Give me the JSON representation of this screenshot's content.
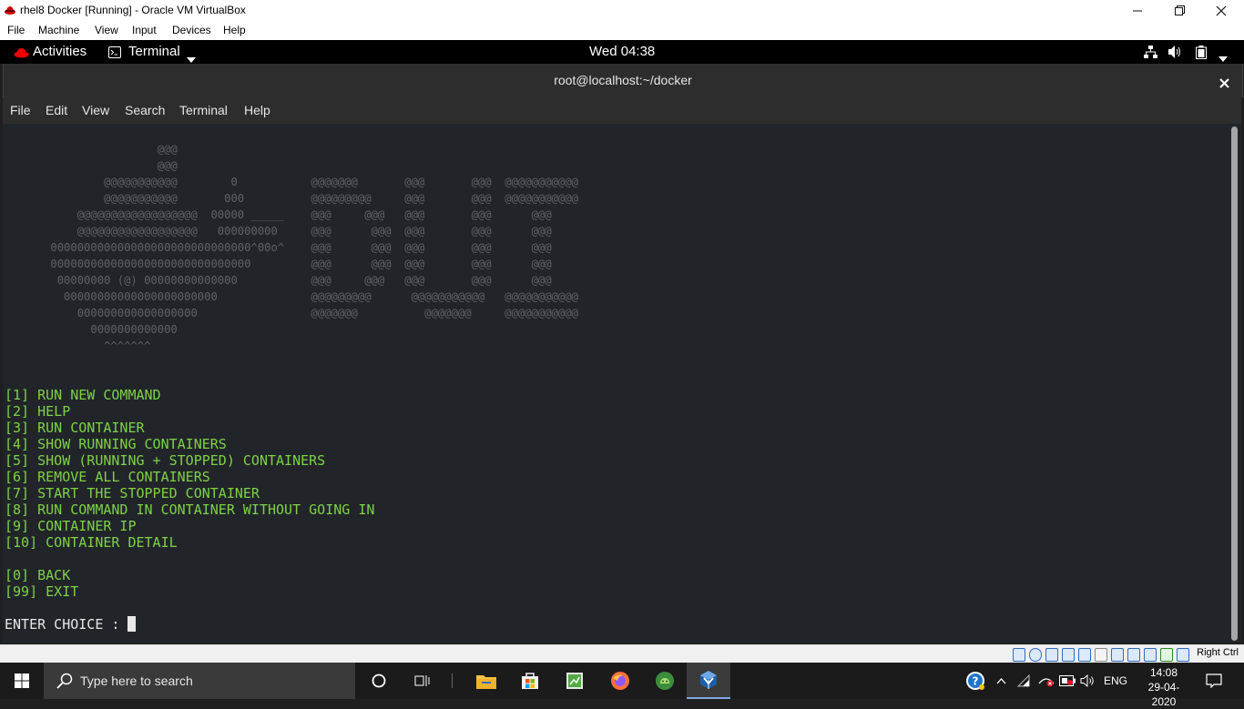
{
  "vbox": {
    "title": "rhel8 Docker [Running] - Oracle VM VirtualBox",
    "menu": [
      "File",
      "Machine",
      "View",
      "Input",
      "Devices",
      "Help"
    ],
    "host_key": "Right Ctrl"
  },
  "gnome": {
    "activities": "Activities",
    "app_menu": "Terminal",
    "clock": "Wed 04:38"
  },
  "terminal": {
    "title": "root@localhost:~/docker",
    "menu": [
      "File",
      "Edit",
      "View",
      "Search",
      "Terminal",
      "Help"
    ],
    "ascii_art": [
      "                       @@@",
      "                       @@@",
      "               @@@@@@@@@@@        0           @@@@@@@       @@@       @@@  @@@@@@@@@@@",
      "               @@@@@@@@@@@       000          @@@@@@@@@     @@@       @@@  @@@@@@@@@@@",
      "           @@@@@@@@@@@@@@@@@@  00000 _____    @@@     @@@   @@@       @@@      @@@",
      "           @@@@@@@@@@@@@@@@@@   000000000     @@@      @@@  @@@       @@@      @@@",
      "       000000000000000000000000000000^00o^    @@@      @@@  @@@       @@@      @@@",
      "       000000000000000000000000000000         @@@      @@@  @@@       @@@      @@@",
      "        00000000 (@) 00000000000000           @@@     @@@   @@@       @@@      @@@",
      "         00000000000000000000000              @@@@@@@@@      @@@@@@@@@@@   @@@@@@@@@@@",
      "           000000000000000000                 @@@@@@@          @@@@@@@     @@@@@@@@@@@",
      "             0000000000000",
      "               ^^^^^^^"
    ],
    "options": [
      "[1] RUN NEW COMMAND",
      "[2] HELP",
      "[3] RUN CONTAINER",
      "[4] SHOW RUNNING CONTAINERS",
      "[5] SHOW (RUNNING + STOPPED) CONTAINERS",
      "[6] REMOVE ALL CONTAINERS",
      "[7] START THE STOPPED CONTAINER",
      "[8] RUN COMMAND IN CONTAINER WITHOUT GOING IN",
      "[9] CONTAINER IP",
      "[10] CONTAINER DETAIL",
      "",
      "[0] BACK",
      "[99] EXIT"
    ],
    "prompt": "ENTER CHOICE : "
  },
  "taskbar": {
    "search_placeholder": "Type here to search",
    "lang": "ENG",
    "time": "14:08",
    "date": "29-04-2020"
  },
  "colors": {
    "terminal_bg": "#212529",
    "menu_green": "#7fd146",
    "ascii_gray": "#5e6266"
  }
}
